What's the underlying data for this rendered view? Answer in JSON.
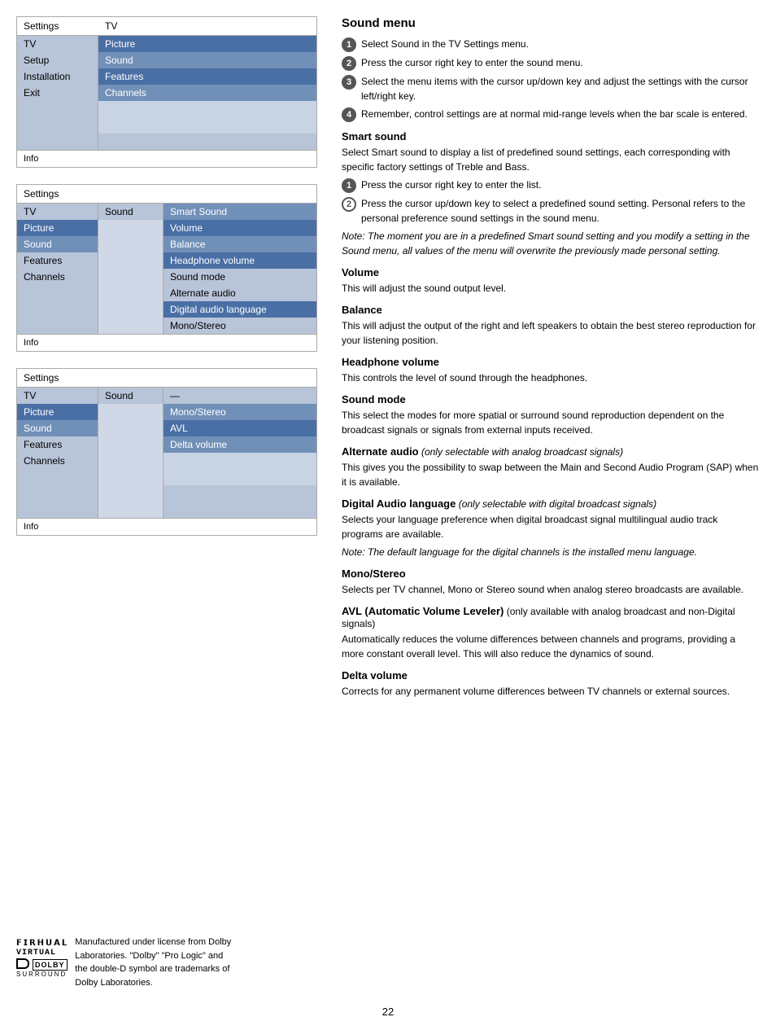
{
  "page": {
    "number": "22"
  },
  "panels": [
    {
      "id": "panel1",
      "header": [
        "Settings",
        "",
        "TV"
      ],
      "col1": {
        "label": "Settings",
        "items": [
          "TV",
          "Setup",
          "Installation",
          "Exit"
        ]
      },
      "col2": {
        "label": "",
        "items": []
      },
      "col3": {
        "label": "TV",
        "items": [
          "Picture",
          "Sound",
          "Features",
          "Channels"
        ]
      },
      "footer": "Info"
    },
    {
      "id": "panel2",
      "header": [
        "Settings",
        "",
        "TV",
        "",
        "Sound"
      ],
      "col1_items": [
        "TV",
        "Picture",
        "Sound",
        "Features",
        "Channels"
      ],
      "col2_items": [
        "Smart Sound",
        "Volume",
        "Balance",
        "Headphone volume",
        "Sound mode",
        "Alternate audio",
        "Digital audio language",
        "Mono/Stereo"
      ],
      "footer": "Info"
    },
    {
      "id": "panel3",
      "header": [
        "Settings",
        "",
        "TV",
        "",
        "Sound"
      ],
      "col1_items": [
        "TV",
        "Picture",
        "Sound",
        "Features",
        "Channels"
      ],
      "col2_items": [
        "—",
        "Mono/Stereo",
        "AVL",
        "Delta volume"
      ],
      "footer": "Info"
    }
  ],
  "right": {
    "main_title": "Sound menu",
    "steps": [
      "Select Sound in the TV Settings menu.",
      "Press the cursor right key to enter the sound menu.",
      "Select the menu items with the cursor up/down key and adjust the settings with the cursor left/right key.",
      "Remember, control settings are at normal mid-range levels when the bar scale is entered."
    ],
    "sections": [
      {
        "title": "Smart sound",
        "body": "Select Smart sound to display a list of predefined sound settings, each corresponding with specific factory settings of Treble and Bass.",
        "substeps": [
          "Press the cursor right key to enter the list.",
          "Press the cursor up/down key to select a predefined sound setting. Personal refers to the personal preference sound settings in the sound menu."
        ],
        "note": "Note: The moment you are in a predefined Smart sound setting and you modify a setting in the Sound menu, all values of the menu will overwrite the previously made personal setting."
      },
      {
        "title": "Volume",
        "body": "This will adjust the sound output level."
      },
      {
        "title": "Balance",
        "body": "This will adjust the output of the right and left speakers to obtain the best stereo reproduction for your listening position."
      },
      {
        "title": "Headphone volume",
        "body": "This controls the level of sound through the headphones."
      },
      {
        "title": "Sound mode",
        "body": "This select the modes for more spatial or surround sound reproduction dependent on the broadcast signals or signals from external inputs received."
      },
      {
        "title": "Alternate audio",
        "title_suffix": " (only selectable with analog broadcast signals)",
        "body": "This gives you the possibility to swap between the Main and Second Audio Program (SAP) when it is available."
      },
      {
        "title": "Digital Audio language",
        "title_suffix": " (only selectable with digital broadcast signals)",
        "body": "Selects your language preference when digital broadcast signal multilingual audio track programs are available.",
        "note": "Note: The default language for the digital channels is the installed menu language."
      },
      {
        "title": "Mono/Stereo",
        "body": "Selects per TV channel, Mono or Stereo sound when analog stereo broadcasts are available."
      },
      {
        "title": "AVL (Automatic Volume Leveler)",
        "title_suffix": " (only available with analog broadcast and non-Digital signals)",
        "body": "Automatically reduces the volume differences between channels and programs, providing a more constant overall level. This will also reduce the dynamics of sound."
      },
      {
        "title": "Delta volume",
        "body": "Corrects for any permanent volume differences between TV channels or external sources."
      }
    ],
    "footer": {
      "virtual_text": "VIRTUAL",
      "dolby_text": "Manufactured under license from Dolby Laboratories. \"Dolby\" \"Pro Logic\" and the double-D symbol are trademarks of Dolby Laboratories."
    }
  }
}
